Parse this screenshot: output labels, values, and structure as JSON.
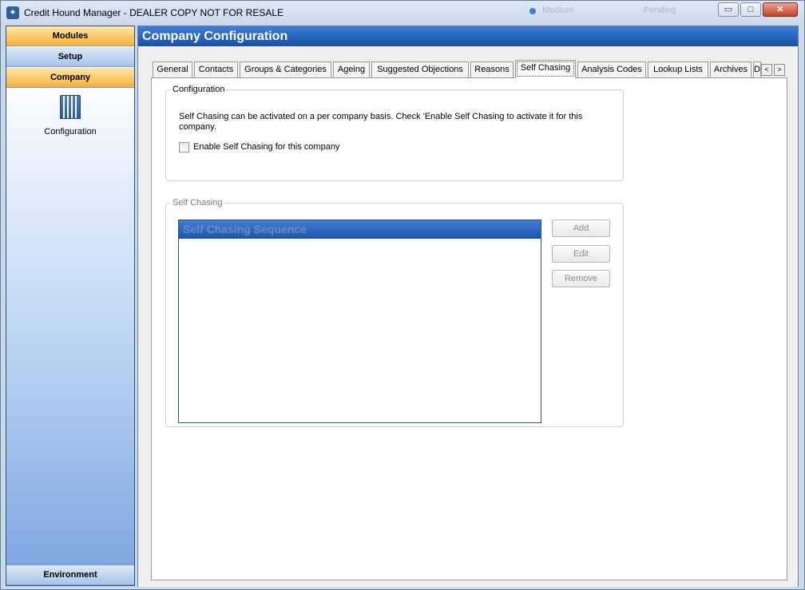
{
  "window": {
    "title": "Credit Hound Manager - DEALER COPY NOT FOR RESALE",
    "background_items": [
      "Medium",
      "Pending"
    ],
    "controls": {
      "minimize": "▭",
      "maximize": "□",
      "close": "✕"
    }
  },
  "sidebar": {
    "modules_label": "Modules",
    "setup_label": "Setup",
    "company_label": "Company",
    "items": [
      {
        "label": "Configuration",
        "icon": "building-icon"
      }
    ],
    "environment_label": "Environment"
  },
  "main": {
    "title": "Company Configuration",
    "tabs": [
      {
        "label": "General"
      },
      {
        "label": "Contacts"
      },
      {
        "label": "Groups & Categories"
      },
      {
        "label": "Ageing"
      },
      {
        "label": "Suggested Objections"
      },
      {
        "label": "Reasons"
      },
      {
        "label": "Self Chasing",
        "active": true
      },
      {
        "label": "Analysis Codes"
      },
      {
        "label": "Lookup Lists"
      },
      {
        "label": "Archives"
      },
      {
        "label": "D"
      }
    ],
    "tab_scroll": {
      "left": "<",
      "right": ">"
    }
  },
  "configuration": {
    "legend": "Configuration",
    "description": "Self Chasing can be activated on a per company basis.  Check 'Enable Self Chasing to activate it for this company.",
    "checkbox_label": "Enable Self Chasing for this company",
    "checkbox_checked": false
  },
  "self_chasing": {
    "legend": "Self Chasing",
    "list_header": "Self Chasing Sequence",
    "buttons": {
      "add": "Add",
      "edit": "Edit",
      "remove": "Remove"
    }
  },
  "colors": {
    "header_blue": "#1a4fa6",
    "sidebar_orange": "#f6b13a"
  }
}
